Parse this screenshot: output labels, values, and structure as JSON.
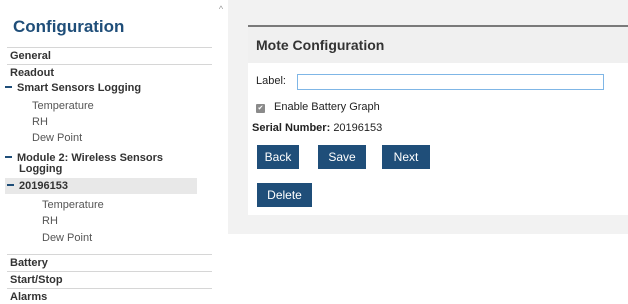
{
  "sidebar": {
    "title": "Configuration",
    "items": {
      "general": "General",
      "readout": "Readout",
      "smart_sensors": "Smart Sensors Logging",
      "smart_temperature": "Temperature",
      "smart_rh": "RH",
      "smart_dewpoint": "Dew Point",
      "module2_line1": "Module 2: Wireless Sensors",
      "module2_line2": "Logging",
      "mote": "20196153",
      "mote_temperature": "Temperature",
      "mote_rh": "RH",
      "mote_dewpoint": "Dew Point",
      "battery": "Battery",
      "startstop": "Start/Stop",
      "alarms": "Alarms"
    }
  },
  "scroll": {
    "up_glyph": "^"
  },
  "main": {
    "title": "Mote Configuration",
    "label_field": {
      "label": "Label:",
      "value": "",
      "placeholder": ""
    },
    "battery_graph": {
      "label": "Enable Battery Graph",
      "checked": true,
      "check_glyph": "✔"
    },
    "serial": {
      "label": "Serial Number:",
      "value": "20196153"
    },
    "buttons": {
      "back": "Back",
      "save": "Save",
      "next": "Next",
      "delete": "Delete"
    }
  },
  "colors": {
    "accent": "#1f4e79",
    "input_border": "#7fb6e6"
  }
}
